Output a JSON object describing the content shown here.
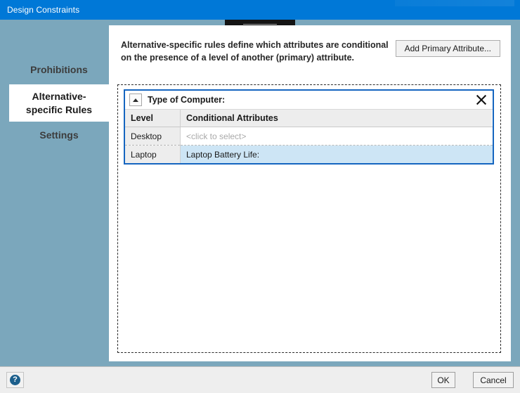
{
  "window": {
    "title": "Design Constraints"
  },
  "drag_tab": {
    "icon": "drag-handle-icon"
  },
  "sidebar": {
    "items": [
      {
        "label": "Prohibitions",
        "selected": false
      },
      {
        "label": "Alternative-specific Rules",
        "selected": true
      },
      {
        "label": "Settings",
        "selected": false
      }
    ]
  },
  "main": {
    "intro_text": "Alternative-specific rules define which attributes are conditional on the presence of a level of another (primary) attribute.",
    "add_primary_button": "Add Primary Attribute...",
    "attribute_panel": {
      "title": "Type of Computer:",
      "collapse_icon": "chevron-up-icon",
      "close_icon": "close-x-icon",
      "columns": [
        "Level",
        "Conditional Attributes"
      ],
      "rows": [
        {
          "level": "Desktop",
          "attributes": "<click to select>",
          "is_placeholder": true,
          "selected": false
        },
        {
          "level": "Laptop",
          "attributes": "Laptop Battery Life:",
          "is_placeholder": false,
          "selected": true
        }
      ]
    }
  },
  "footer": {
    "help_icon": "question-mark-icon",
    "help_glyph": "?",
    "ok_label": "OK",
    "cancel_label": "Cancel"
  },
  "colors": {
    "titlebar": "#0078d7",
    "sidebar": "#7ba7bc",
    "panel_border": "#1565c0",
    "row_selected": "#cde5f5",
    "help_badge": "#1c5f8c"
  }
}
